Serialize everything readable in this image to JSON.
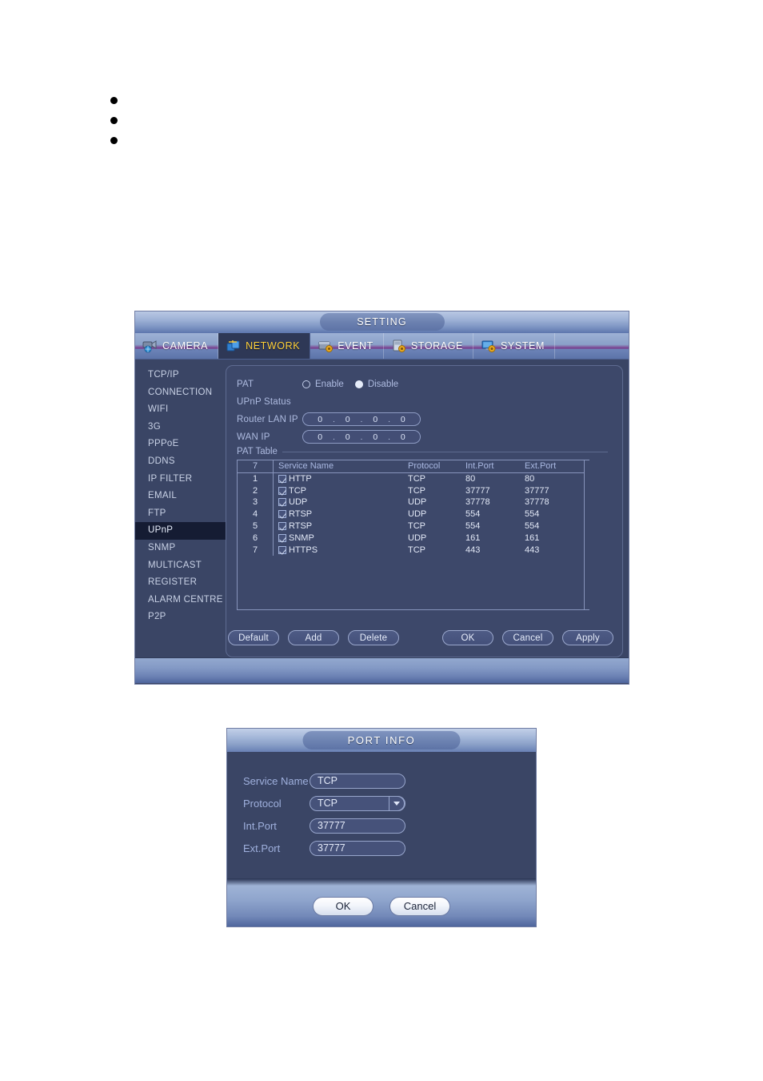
{
  "bullets": [
    {
      "text": ""
    },
    {
      "text": ""
    },
    {
      "text": ""
    }
  ],
  "setting_window": {
    "title": "SETTING",
    "tabs": [
      {
        "label": "CAMERA",
        "icon": "camera-icon",
        "active": false
      },
      {
        "label": "NETWORK",
        "icon": "network-icon",
        "active": true
      },
      {
        "label": "EVENT",
        "icon": "event-icon",
        "active": false
      },
      {
        "label": "STORAGE",
        "icon": "storage-icon",
        "active": false
      },
      {
        "label": "SYSTEM",
        "icon": "system-icon",
        "active": false
      }
    ],
    "sidebar": {
      "items": [
        {
          "label": "TCP/IP",
          "active": false
        },
        {
          "label": "CONNECTION",
          "active": false
        },
        {
          "label": "WIFI",
          "active": false
        },
        {
          "label": "3G",
          "active": false
        },
        {
          "label": "PPPoE",
          "active": false
        },
        {
          "label": "DDNS",
          "active": false
        },
        {
          "label": "IP FILTER",
          "active": false
        },
        {
          "label": "EMAIL",
          "active": false
        },
        {
          "label": "FTP",
          "active": false
        },
        {
          "label": "UPnP",
          "active": true
        },
        {
          "label": "SNMP",
          "active": false
        },
        {
          "label": "MULTICAST",
          "active": false
        },
        {
          "label": "REGISTER",
          "active": false
        },
        {
          "label": "ALARM CENTRE",
          "active": false
        },
        {
          "label": "P2P",
          "active": false
        }
      ]
    },
    "form": {
      "pat_label": "PAT",
      "enable_label": "Enable",
      "disable_label": "Disable",
      "pat_selected": "Disable",
      "upnp_status_label": "UPnP Status",
      "upnp_status_value": "",
      "router_lan_ip_label": "Router LAN IP",
      "router_lan_ip": [
        "0",
        "0",
        "0",
        "0"
      ],
      "wan_ip_label": "WAN IP",
      "wan_ip": [
        "0",
        "0",
        "0",
        "0"
      ],
      "pat_table_label": "PAT Table"
    },
    "table": {
      "headers": {
        "count": "7",
        "service_name": "Service Name",
        "protocol": "Protocol",
        "int_port": "Int.Port",
        "ext_port": "Ext.Port"
      },
      "rows": [
        {
          "idx": "1",
          "checked": true,
          "service_name": "HTTP",
          "protocol": "TCP",
          "int_port": "80",
          "ext_port": "80"
        },
        {
          "idx": "2",
          "checked": true,
          "service_name": "TCP",
          "protocol": "TCP",
          "int_port": "37777",
          "ext_port": "37777"
        },
        {
          "idx": "3",
          "checked": true,
          "service_name": "UDP",
          "protocol": "UDP",
          "int_port": "37778",
          "ext_port": "37778"
        },
        {
          "idx": "4",
          "checked": true,
          "service_name": "RTSP",
          "protocol": "UDP",
          "int_port": "554",
          "ext_port": "554"
        },
        {
          "idx": "5",
          "checked": true,
          "service_name": "RTSP",
          "protocol": "TCP",
          "int_port": "554",
          "ext_port": "554"
        },
        {
          "idx": "6",
          "checked": true,
          "service_name": "SNMP",
          "protocol": "UDP",
          "int_port": "161",
          "ext_port": "161"
        },
        {
          "idx": "7",
          "checked": true,
          "service_name": "HTTPS",
          "protocol": "TCP",
          "int_port": "443",
          "ext_port": "443"
        }
      ]
    },
    "buttons": {
      "default": "Default",
      "add": "Add",
      "delete": "Delete",
      "ok": "OK",
      "cancel": "Cancel",
      "apply": "Apply"
    }
  },
  "dialog": {
    "title": "PORT INFO",
    "fields": {
      "service_name_label": "Service Name",
      "service_name_value": "TCP",
      "protocol_label": "Protocol",
      "protocol_value": "TCP",
      "int_port_label": "Int.Port",
      "int_port_value": "37777",
      "ext_port_label": "Ext.Port",
      "ext_port_value": "37777"
    },
    "buttons": {
      "ok": "OK",
      "cancel": "Cancel"
    }
  },
  "colors": {
    "window_bg": "#3a4565",
    "panel_bg": "#3d486a",
    "active_tab_text": "#ffd13b",
    "sidebar_active_bg": "#151c33",
    "label_text": "#aebbe0"
  }
}
